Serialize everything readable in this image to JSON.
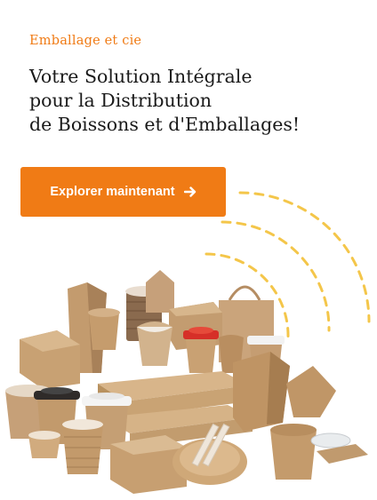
{
  "brand": {
    "name": "Emballage et cie"
  },
  "hero": {
    "headline_lines": [
      "Votre Solution Intégrale",
      "pour la Distribution",
      "de Boissons et d'Emballages!"
    ],
    "cta_label": "Explorer maintenant",
    "cta_icon": "arrow-right-icon"
  },
  "colors": {
    "accent": "#f07b15",
    "ring": "#f4c64a",
    "kraft": "#c9a57a",
    "text": "#1a1a1a"
  }
}
